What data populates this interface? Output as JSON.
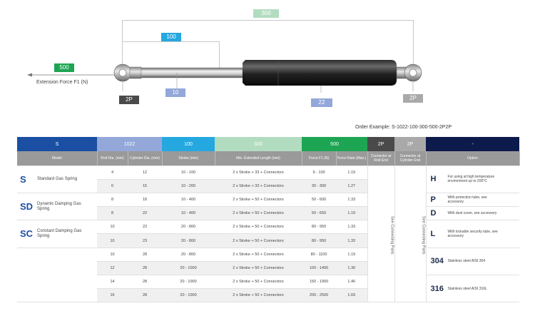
{
  "diagram": {
    "labels": {
      "total_length": "300",
      "stroke": "100",
      "force": "500",
      "extension_force": "Extension Force F1 (N)",
      "rod_dia": "10",
      "cyl_dia": "22",
      "rod_end": "2P",
      "cyl_end": "2P"
    }
  },
  "order_example": "Order Example: S-1022-100-300-500-2P2P",
  "table": {
    "code_row": [
      "S",
      "1022",
      "100",
      "300",
      "500",
      "2P",
      "2P",
      "-"
    ],
    "code_colors": [
      "#1a4fa3",
      "#93a8d9",
      "#25a8e0",
      "#b2dcc0",
      "#1ea553",
      "#4a4a4a",
      "#a9a9a9",
      "#0d1b4c"
    ],
    "headers": [
      "Model",
      "Rod Dia. (mm)",
      "Cylinder Dia. (mm)",
      "Stroke (mm)",
      "Min. Extended Length (mm)",
      "Force F1 (N)",
      "Force Rate (Max.)",
      "Connector at Rod End",
      "Connector at Cylinder End",
      "Option"
    ],
    "models": [
      {
        "code": "S",
        "desc": "Standard Gas Spring"
      },
      {
        "code": "SD",
        "desc": "Dynamic Damping Gas Spring"
      },
      {
        "code": "SC",
        "desc": "Constant Damping Gas Spring"
      }
    ],
    "rows": [
      [
        "4",
        "12",
        "10 - 100",
        "2 x Stroke + 33 + Connectors",
        "9 - 100",
        "1.19"
      ],
      [
        "6",
        "15",
        "10 - 200",
        "2 x Stroke + 33 + Connectors",
        "30 - 300",
        "1.27"
      ],
      [
        "8",
        "18",
        "10 - 400",
        "2 x Stroke + 50 + Connectors",
        "50 - 600",
        "1.33"
      ],
      [
        "8",
        "22",
        "10 - 400",
        "2 x Stroke + 50 + Connectors",
        "50 - 650",
        "1.19"
      ],
      [
        "10",
        "22",
        "20 - 800",
        "2 x Stroke + 50 + Connectors",
        "80 - 950",
        "1.33"
      ],
      [
        "10",
        "23",
        "20 - 800",
        "2 x Stroke + 50 + Connectors",
        "80 - 950",
        "1.33"
      ],
      [
        "10",
        "28",
        "20 - 800",
        "2 x Stroke + 50 + Connectors",
        "80 - 1100",
        "1.19"
      ],
      [
        "12",
        "28",
        "20 - 1000",
        "2 x Stroke + 50 + Connectors",
        "100 - 1400",
        "1.30"
      ],
      [
        "14",
        "28",
        "20 - 1000",
        "2 x Stroke + 50 + Connectors",
        "150 - 1900",
        "1.46"
      ],
      [
        "16",
        "28",
        "20 - 1000",
        "2 x Stroke + 50 + Connectors",
        "200 - 2500",
        "1.69"
      ]
    ],
    "connector_rod": "See Connecting Parts",
    "connector_cyl": "See Connecting Parts",
    "options": [
      {
        "code": "H",
        "desc": "For using at high temperature environment up to 200°C"
      },
      {
        "code": "P",
        "desc": "With protection tube, see accessory"
      },
      {
        "code": "D",
        "desc": "With dust cover, see accessory"
      },
      {
        "code": "L",
        "desc": "With lockable security tube, see accessory"
      },
      {
        "code": "304",
        "desc": "Stainless steel AISI 304"
      },
      {
        "code": "316",
        "desc": "Stainless steel AISI 316L"
      }
    ]
  }
}
